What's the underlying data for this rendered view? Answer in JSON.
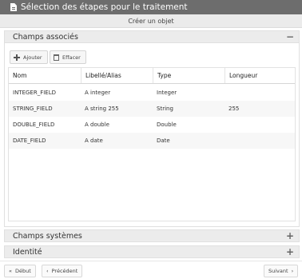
{
  "window": {
    "title": "Sélection des étapes pour le traitement",
    "subtitle": "Créer un objet"
  },
  "panels": {
    "associated": {
      "title": "Champs associés",
      "toggle": "−"
    },
    "system": {
      "title": "Champs systèmes",
      "toggle": "+"
    },
    "identity": {
      "title": "Identité",
      "toggle": "+"
    }
  },
  "toolbar": {
    "add_label": "Ajouter",
    "clear_label": "Effacer"
  },
  "table": {
    "columns": [
      "Nom",
      "Libellé/Alias",
      "Type",
      "Longueur"
    ],
    "rows": [
      [
        "INTEGER_FIELD",
        "A integer",
        "Integer",
        ""
      ],
      [
        "STRING_FIELD",
        "A string 255",
        "String",
        "255"
      ],
      [
        "DOUBLE_FIELD",
        "A double",
        "Double",
        ""
      ],
      [
        "DATE_FIELD",
        "A date",
        "Date",
        ""
      ]
    ]
  },
  "footer": {
    "first_label": "Début",
    "first_icon": "«",
    "prev_label": "Précédent",
    "prev_icon": "‹",
    "next_label": "Suivant",
    "next_icon": "›"
  }
}
